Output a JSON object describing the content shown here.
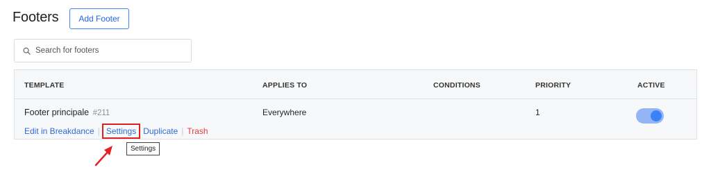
{
  "header": {
    "title": "Footers",
    "add_button_label": "Add Footer"
  },
  "search": {
    "placeholder": "Search for footers",
    "value": ""
  },
  "table": {
    "columns": [
      "TEMPLATE",
      "APPLIES TO",
      "CONDITIONS",
      "PRIORITY",
      "ACTIVE"
    ],
    "rows": [
      {
        "name": "Footer principale",
        "id": "#211",
        "actions": {
          "edit": "Edit in Breakdance",
          "settings": "Settings",
          "duplicate": "Duplicate",
          "trash": "Trash"
        },
        "applies_to": "Everywhere",
        "conditions": "",
        "priority": "1",
        "active": true
      }
    ]
  },
  "tooltip": {
    "text": "Settings"
  },
  "colors": {
    "accent": "#2b6cd8",
    "danger": "#e03b3b",
    "highlight": "#e02020",
    "toggle_on": "#3b82f6"
  }
}
